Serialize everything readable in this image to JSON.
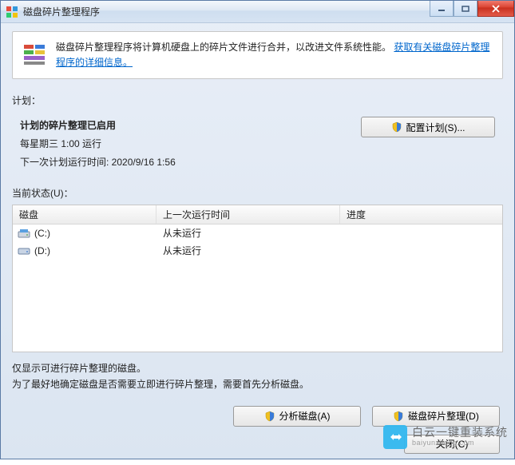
{
  "window": {
    "title": "磁盘碎片整理程序"
  },
  "info": {
    "text_prefix": "磁盘碎片整理程序将计算机硬盘上的碎片文件进行合并，以改进文件系统性能。",
    "link_text": "获取有关磁盘碎片整理程序的详细信息。"
  },
  "schedule": {
    "label": "计划：",
    "title": "计划的碎片整理已启用",
    "line1": "每星期三 1:00 运行",
    "line2": "下一次计划运行时间: 2020/9/16 1:56",
    "config_button": "配置计划(S)..."
  },
  "status": {
    "label": "当前状态(U)："
  },
  "table": {
    "headers": {
      "disk": "磁盘",
      "lastrun": "上一次运行时间",
      "progress": "进度"
    },
    "rows": [
      {
        "name": "(C:)",
        "lastrun": "从未运行",
        "progress": "",
        "icon": "system"
      },
      {
        "name": "(D:)",
        "lastrun": "从未运行",
        "progress": "",
        "icon": "hdd"
      }
    ]
  },
  "note": {
    "line1": "仅显示可进行碎片整理的磁盘。",
    "line2": "为了最好地确定磁盘是否需要立即进行碎片整理，需要首先分析磁盘。"
  },
  "actions": {
    "analyze": "分析磁盘(A)",
    "defrag": "磁盘碎片整理(D)",
    "close": "关闭(C)"
  },
  "watermark": {
    "main": "白云一键重装系统",
    "sub": "baiyunxitong.com"
  }
}
